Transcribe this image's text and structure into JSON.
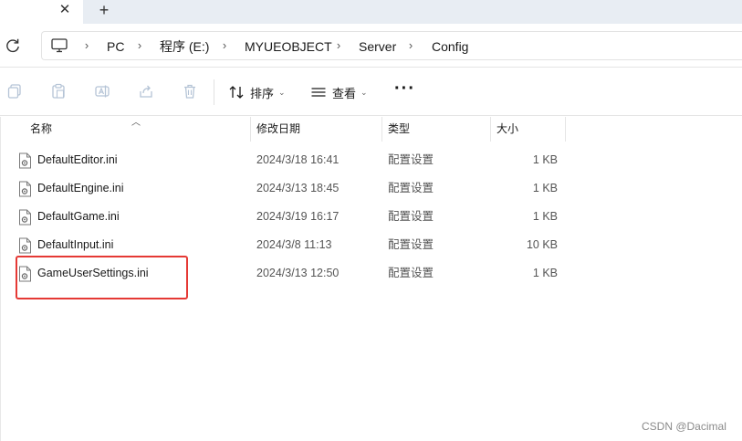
{
  "tabs": {
    "close_glyph": "✕",
    "new_tab_glyph": "+"
  },
  "address": {
    "crumbs": [
      "PC",
      "程序 (E:)",
      "MYUEOBJECT",
      "Server",
      "Config"
    ],
    "separator": "›"
  },
  "commands": {
    "sort_label": "排序",
    "view_label": "查看",
    "more_label": "···",
    "chevron": "⌄"
  },
  "columns": {
    "name": "名称",
    "modified": "修改日期",
    "type": "类型",
    "size": "大小"
  },
  "files": [
    {
      "name": "DefaultEditor.ini",
      "modified": "2024/3/18 16:41",
      "type": "配置设置",
      "size": "1 KB"
    },
    {
      "name": "DefaultEngine.ini",
      "modified": "2024/3/13 18:45",
      "type": "配置设置",
      "size": "1 KB"
    },
    {
      "name": "DefaultGame.ini",
      "modified": "2024/3/19 16:17",
      "type": "配置设置",
      "size": "1 KB"
    },
    {
      "name": "DefaultInput.ini",
      "modified": "2024/3/8 11:13",
      "type": "配置设置",
      "size": "10 KB"
    },
    {
      "name": "GameUserSettings.ini",
      "modified": "2024/3/13 12:50",
      "type": "配置设置",
      "size": "1 KB"
    }
  ],
  "watermark": "CSDN @Dacimal",
  "colors": {
    "highlight": "#e53935",
    "tabstrip": "#e8edf3"
  }
}
